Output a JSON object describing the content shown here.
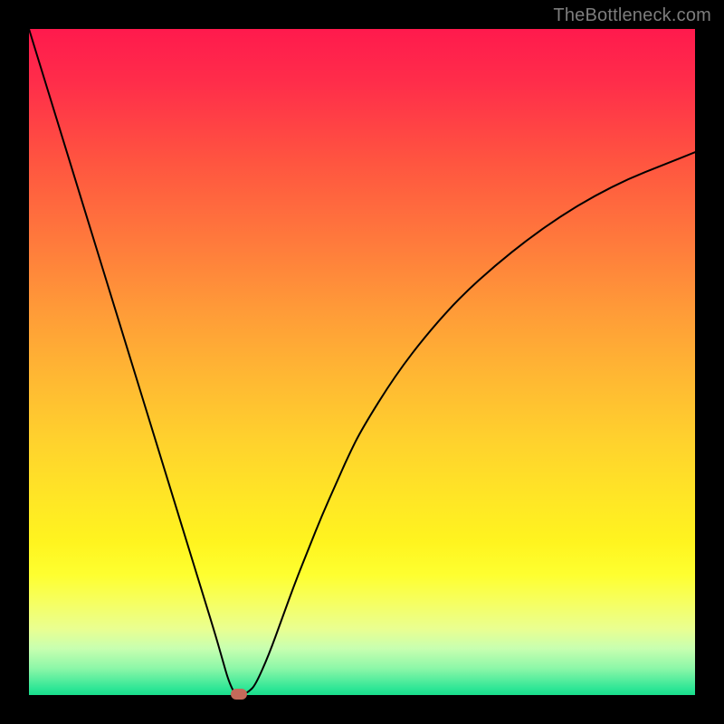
{
  "watermark": "TheBottleneck.com",
  "colors": {
    "frame": "#000000",
    "gradient_top": "#ff1a4d",
    "gradient_bottom": "#18dd8c",
    "curve_stroke": "#000000",
    "marker_fill": "#c46a5a"
  },
  "chart_data": {
    "type": "line",
    "title": "",
    "xlabel": "",
    "ylabel": "",
    "xlim": [
      0,
      100
    ],
    "ylim": [
      0,
      100
    ],
    "grid": false,
    "legend": false,
    "series": [
      {
        "name": "bottleneck-curve",
        "x": [
          0,
          2,
          4,
          6,
          8,
          10,
          12,
          14,
          16,
          18,
          20,
          22,
          24,
          26,
          28,
          29,
          30,
          31,
          32,
          33,
          34,
          36,
          38,
          40,
          42,
          44,
          46,
          48,
          50,
          55,
          60,
          65,
          70,
          75,
          80,
          85,
          90,
          95,
          100
        ],
        "y": [
          100,
          93.5,
          87,
          80.5,
          74,
          67.5,
          61,
          54.5,
          48,
          41.5,
          35,
          28.5,
          22,
          15.5,
          9,
          5.5,
          2,
          0,
          0,
          0.5,
          1.5,
          6,
          11.5,
          17,
          22,
          27,
          31.5,
          36,
          40,
          48,
          54.5,
          60,
          64.5,
          68.5,
          72,
          75,
          77.5,
          79.5,
          81.5
        ]
      }
    ],
    "annotations": [
      {
        "name": "min-marker",
        "x": 31.5,
        "y": 0
      }
    ]
  }
}
